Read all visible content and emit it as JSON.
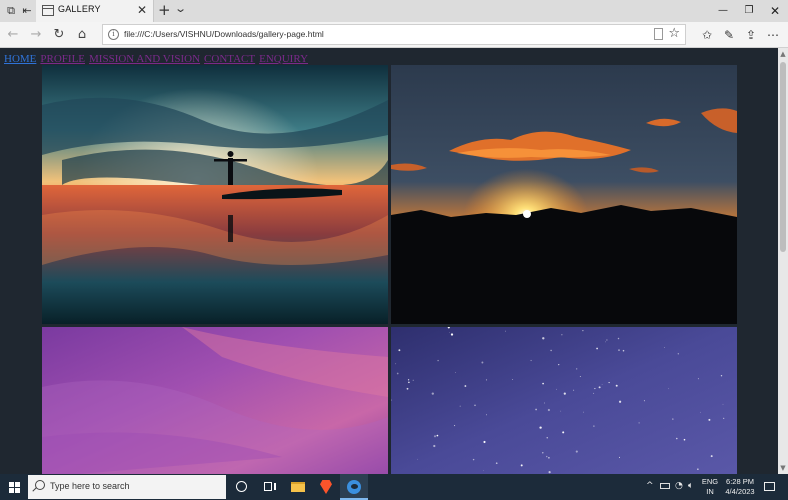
{
  "browser": {
    "tab": {
      "title": "GALLERY",
      "close_glyph": "✕"
    },
    "address": {
      "url": "file:///C:/Users/VISHNU/Downloads/gallery-page.html"
    },
    "new_tab_glyph": "+",
    "window_controls": {
      "minimize": "—",
      "maximize": "❐",
      "close": "✕"
    }
  },
  "page": {
    "nav": {
      "home": "HOME",
      "profile": "PROFILE",
      "mission": "MISSION AND VISION",
      "contact": "CONTACT",
      "enquiry": "ENQUIRY"
    },
    "gallery": [
      {
        "subject": "silhouette-sunset-reflection",
        "alt_colors": [
          "#1c4b5a",
          "#f28a3a",
          "#0d2230"
        ]
      },
      {
        "subject": "mountain-sunset",
        "alt_colors": [
          "#2b3d52",
          "#ff9a2e",
          "#050608"
        ]
      },
      {
        "subject": "purple-sky",
        "alt_colors": [
          "#8e3fa8",
          "#b95fb6",
          "#d07aa8"
        ]
      },
      {
        "subject": "starry-sky",
        "alt_colors": [
          "#3a3f8a",
          "#5a58a8",
          "#2c2f6e"
        ]
      }
    ]
  },
  "taskbar": {
    "search_placeholder": "Type here to search",
    "language_line1": "ENG",
    "language_line2": "IN",
    "time": "6:28 PM",
    "date": "4/4/2023"
  },
  "icons": [
    "start-icon",
    "cortana-icon",
    "task-view-icon",
    "file-explorer-icon",
    "brave-icon",
    "edge-icon",
    "tray-chevron-icon",
    "battery-icon",
    "wifi-icon",
    "volume-icon",
    "notification-icon"
  ]
}
